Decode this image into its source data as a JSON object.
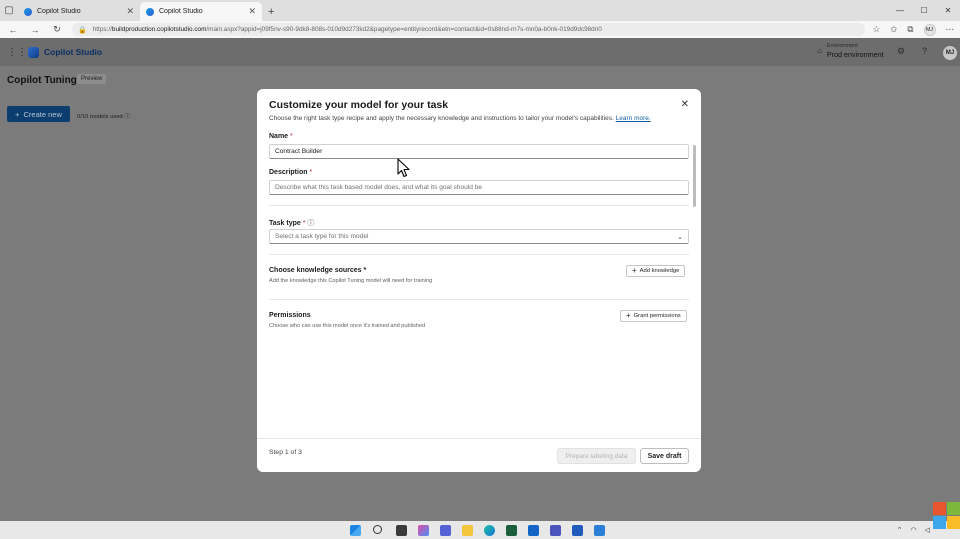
{
  "browser": {
    "tabs": [
      {
        "title": "Copilot Studio",
        "active": false
      },
      {
        "title": "Copilot Studio",
        "active": true
      }
    ],
    "url_prefix": "https://",
    "url_domain": "buildproduction.copilotstudio.com",
    "url_path": "/main.aspx?appid=j09f5nv-s90-9dk8-808s-010d9d273kd2&pagetype=entityrecord&etn=contact&id=0s88nd-rn7s-mn0a-b0nk-019d9dc98dn0",
    "profile_initials": "MJ"
  },
  "app": {
    "name": "Copilot Studio",
    "env_label": "Environment",
    "env_name": "Prod environment",
    "user_initials": "MJ"
  },
  "page": {
    "title": "Copilot Tuning",
    "badge": "Preview",
    "create_label": "Create new",
    "models_used": "0/10 models used"
  },
  "modal": {
    "title": "Customize your model for your task",
    "subtitle": "Choose the right task type recipe and apply the necessary knowledge and instructions to tailor your model's capabilities.",
    "learn_more": "Learn more.",
    "name_label": "Name",
    "name_value": "Contract Builder",
    "description_label": "Description",
    "description_placeholder": "Describe what this task based model does, and what its goal should be",
    "task_type_label": "Task type",
    "task_type_placeholder": "Select a task type for this model",
    "knowledge_label": "Choose knowledge sources",
    "knowledge_desc": "Add the knowledge this Copilot Tuning model will need for training",
    "add_knowledge": "Add knowledge",
    "permissions_label": "Permissions",
    "permissions_desc": "Choose who can use this model once it's trained and published",
    "grant_permissions": "Grant permissions",
    "step": "Step 1 of 3",
    "prepare_button": "Prepare labeling data",
    "save_button": "Save draft",
    "required_mark": "*"
  },
  "colors": {
    "primary": "#0b3d6e",
    "link": "#115ea3",
    "required": "#a4262c",
    "overlay": "#7b7b7b"
  }
}
